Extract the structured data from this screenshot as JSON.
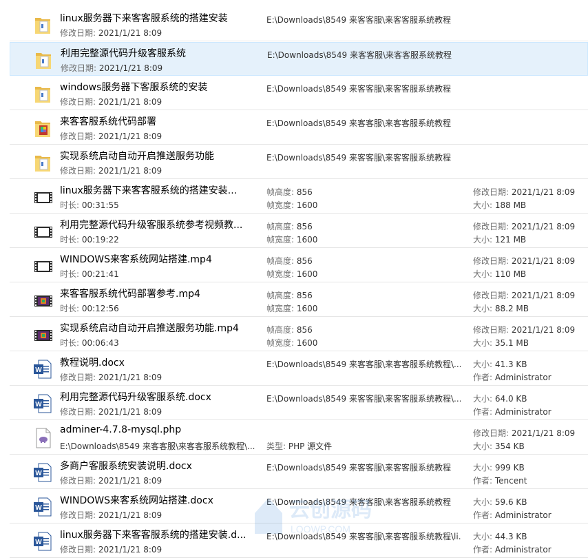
{
  "labels": {
    "modified": "修改日期: ",
    "duration": "时长: ",
    "frame_height": "帧高度: ",
    "frame_width": "帧宽度: ",
    "size": "大小: ",
    "author": "作者: ",
    "type": "类型: "
  },
  "rows": [
    {
      "icon": "folder",
      "name": "linux服务器下来客客服系统的搭建安装",
      "modified": "2021/1/21 8:09",
      "path": "E:\\Downloads\\8549 来客客服\\来客客服系统教程"
    },
    {
      "icon": "folder",
      "name": "利用完整源代码升级客服系统",
      "modified": "2021/1/21 8:09",
      "path": "E:\\Downloads\\8549 来客客服\\来客客服系统教程",
      "selected": true
    },
    {
      "icon": "folder",
      "name": "windows服务器下客服系统的安装",
      "modified": "2021/1/21 8:09",
      "path": "E:\\Downloads\\8549 来客客服\\来客客服系统教程"
    },
    {
      "icon": "folder-color",
      "name": "来客客服系统代码部署",
      "modified": "2021/1/21 8:09",
      "path": "E:\\Downloads\\8549 来客客服\\来客客服系统教程"
    },
    {
      "icon": "folder",
      "name": "实现系统启动自动开启推送服务功能",
      "modified": "2021/1/21 8:09",
      "path": "E:\\Downloads\\8549 来客客服\\来客客服系统教程"
    },
    {
      "icon": "video",
      "name": "linux服务器下来客客服系统的搭建安装...",
      "duration": "00:31:55",
      "frame_height": "856",
      "frame_width": "1600",
      "modified": "2021/1/21 8:09",
      "size": "188 MB"
    },
    {
      "icon": "video",
      "name": "利用完整源代码升级客服系统参考视频教...",
      "duration": "00:19:22",
      "frame_height": "856",
      "frame_width": "1600",
      "modified": "2021/1/21 8:09",
      "size": "121 MB"
    },
    {
      "icon": "video",
      "name": "WINDOWS来客系统网站搭建.mp4",
      "duration": "00:21:41",
      "frame_height": "856",
      "frame_width": "1600",
      "modified": "2021/1/21 8:09",
      "size": "110 MB"
    },
    {
      "icon": "video-color",
      "name": "来客客服系统代码部署参考.mp4",
      "duration": "00:12:56",
      "frame_height": "856",
      "frame_width": "1600",
      "modified": "2021/1/21 8:09",
      "size": "88.2 MB"
    },
    {
      "icon": "video-color",
      "name": "实现系统启动自动开启推送服务功能.mp4",
      "duration": "00:06:43",
      "frame_height": "856",
      "frame_width": "1600",
      "modified": "2021/1/21 8:09",
      "size": "35.1 MB"
    },
    {
      "icon": "word",
      "name": "教程说明.docx",
      "modified": "2021/1/21 8:09",
      "path": "E:\\Downloads\\8549 来客客服\\来客客服系统教程\\...",
      "size": "41.3 KB",
      "author": "Administrator"
    },
    {
      "icon": "word",
      "name": "利用完整源代码升级客服系统.docx",
      "modified": "2021/1/21 8:09",
      "path": "E:\\Downloads\\8549 来客客服\\来客客服系统教程\\...",
      "size": "64.0 KB",
      "author": "Administrator"
    },
    {
      "icon": "php",
      "name": "adminer-4.7.8-mysql.php",
      "path2": "E:\\Downloads\\8549 来客客服\\来客客服系统教程\\...",
      "type": "PHP 源文件",
      "modified": "2021/1/21 8:09",
      "size": "354 KB"
    },
    {
      "icon": "word",
      "name": "多商户客服系统安装说明.docx",
      "modified": "2021/1/21 8:09",
      "path": "E:\\Downloads\\8549 来客客服\\来客客服系统教程",
      "size": "999 KB",
      "author": "Tencent"
    },
    {
      "icon": "word",
      "name": "WINDOWS来客系统网站搭建.docx",
      "modified": "2021/1/21 8:09",
      "path": "E:\\Downloads\\8549 来客客服\\来客客服系统教程",
      "size": "59.6 KB",
      "author": "Administrator"
    },
    {
      "icon": "word",
      "name": "linux服务器下来客客服系统的搭建安装.d...",
      "modified": "2021/1/21 8:09",
      "path": "E:\\Downloads\\8549 来客客服\\来客客服系统教程\\li...",
      "size": "44.3 KB",
      "author": "Administrator"
    }
  ],
  "watermark": {
    "line1": "云创源码",
    "line2": "LOOWP.COM"
  },
  "colors": {
    "folder": "#f5c95a",
    "word": "#2b579a",
    "selected_bg": "#e5f1fb",
    "php": "#8a6fb8"
  }
}
